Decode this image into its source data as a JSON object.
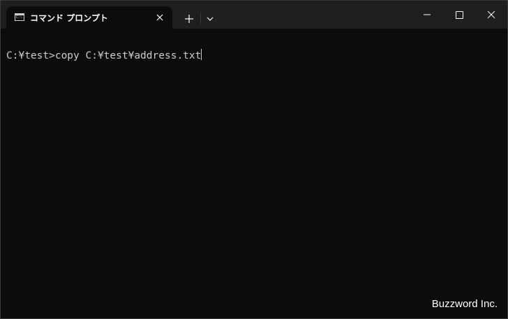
{
  "window": {
    "tab": {
      "title": "コマンド プロンプト",
      "icon": "command-prompt-icon",
      "close_icon": "close-icon"
    },
    "new_tab_icon": "plus-icon",
    "dropdown_icon": "chevron-down-icon",
    "controls": {
      "minimize_icon": "minimize-icon",
      "maximize_icon": "maximize-icon",
      "close_icon": "close-icon"
    }
  },
  "terminal": {
    "prompt": "C:¥test>",
    "command": "copy C:¥test¥address.txt"
  },
  "watermark": "Buzzword Inc.",
  "colors": {
    "titlebar": "#1f1f1f",
    "background": "#0c0c0c",
    "text": "#cccccc"
  }
}
